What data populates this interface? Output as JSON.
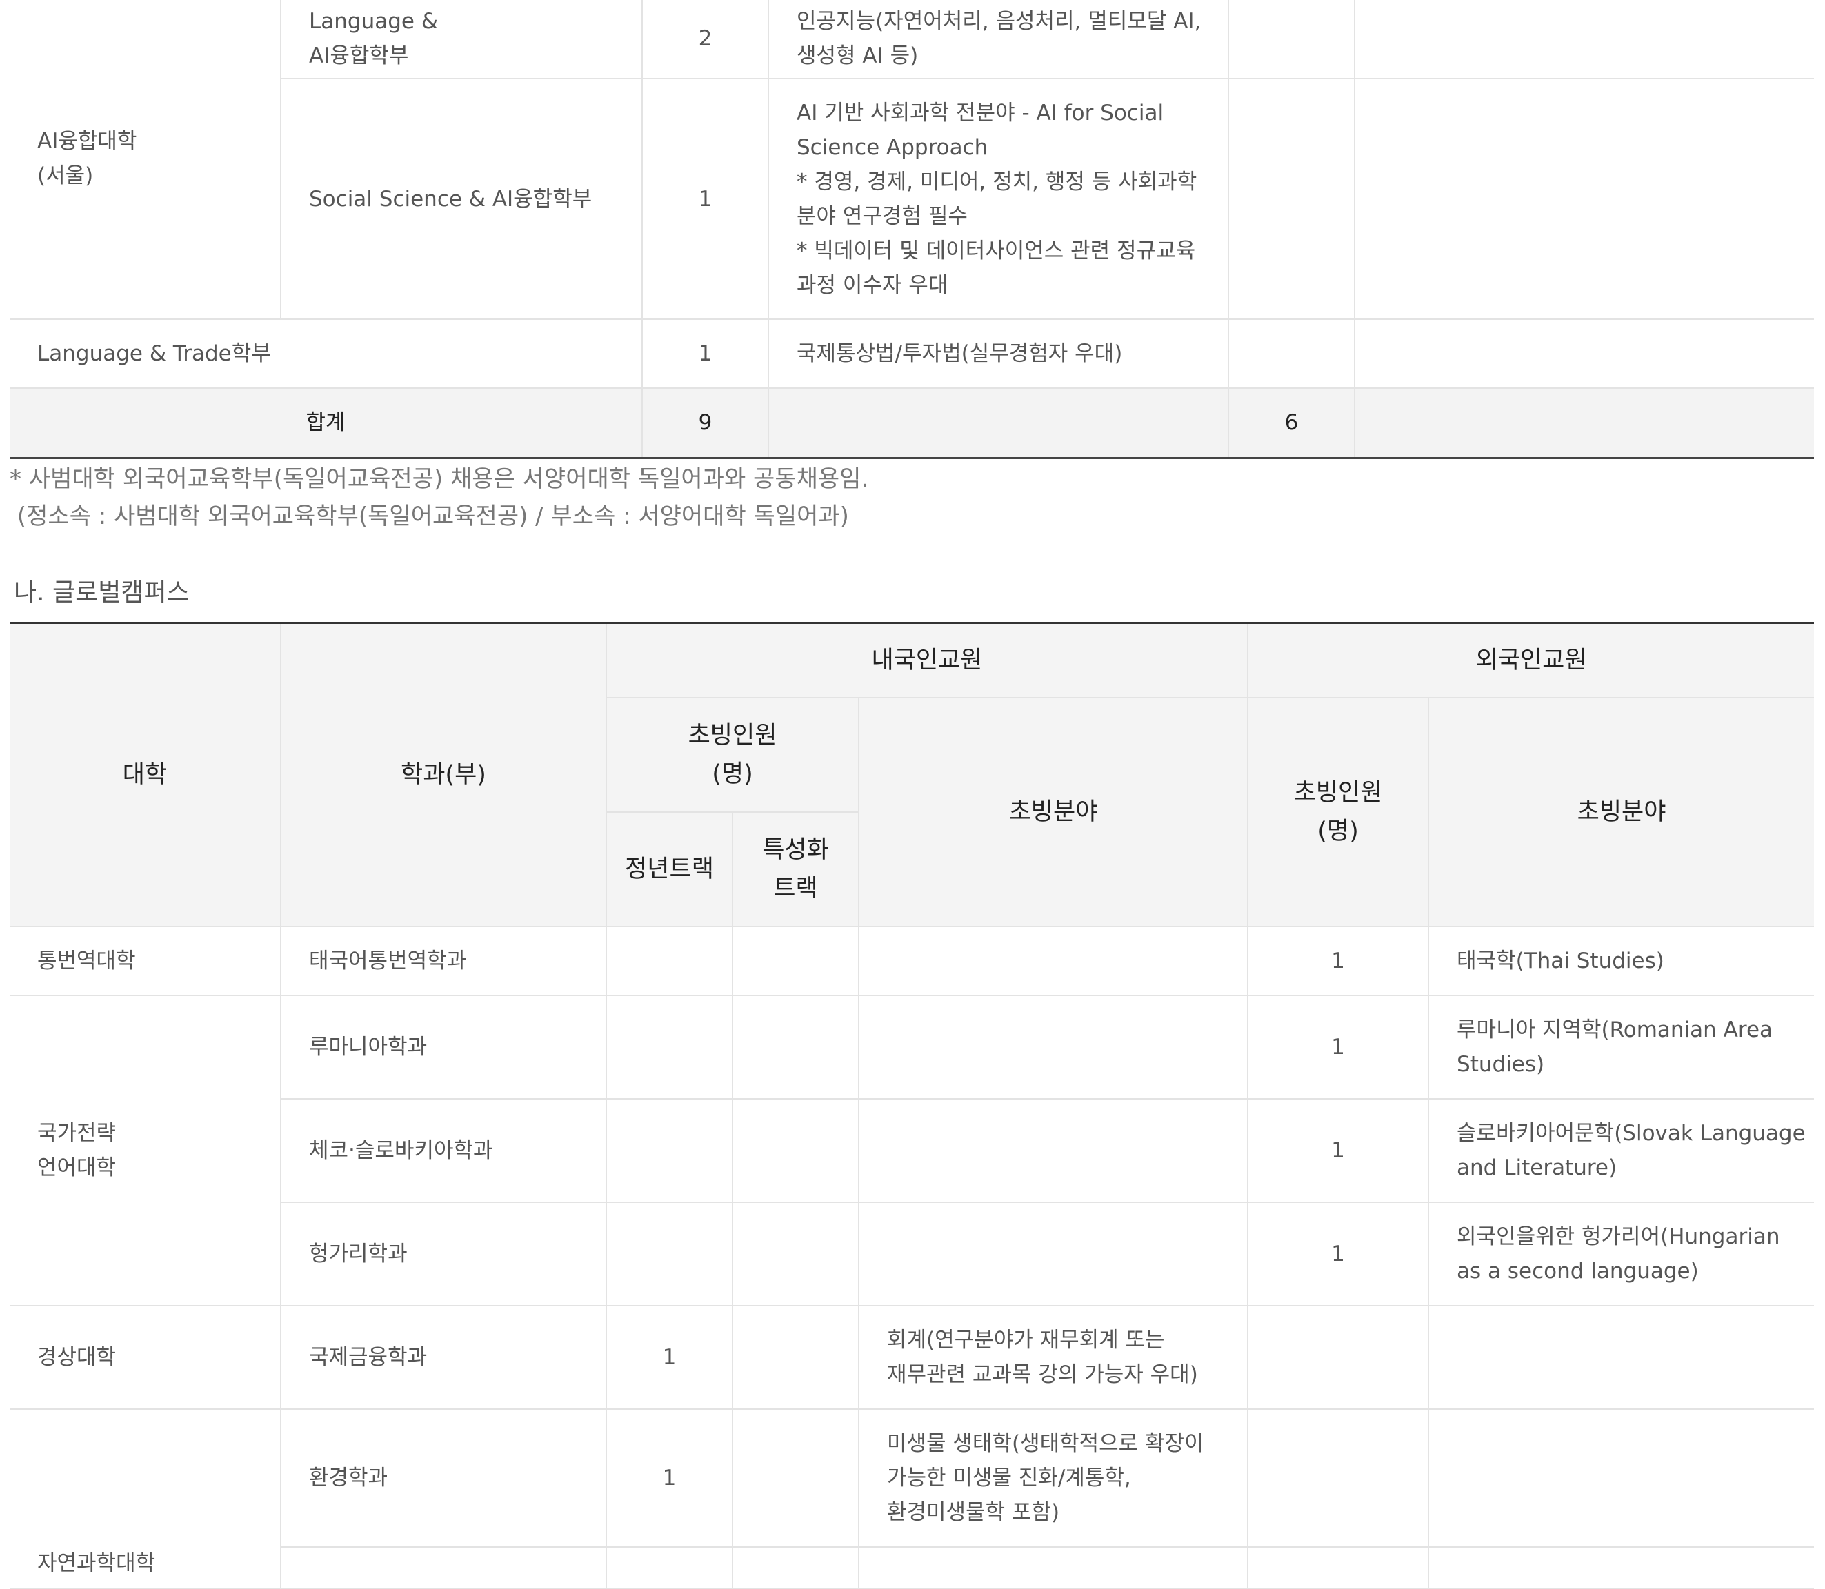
{
  "upper_table": {
    "rows": [
      {
        "college": "AI융합대학\n(서울)",
        "department": "Language &\nAI융합학부",
        "count": "2",
        "field": "인공지능(자연어처리, 음성처리, 멀티모달 AI,\n생성형 AI 등)",
        "foreign_count": "",
        "foreign_field": ""
      },
      {
        "department": "Social Science & AI융합학부",
        "count": "1",
        "field": "AI 기반 사회과학 전분야 - AI for Social\nScience Approach\n* 경영, 경제, 미디어, 정치, 행정 등 사회과학\n분야 연구경험 필수\n* 빅데이터 및 데이터사이언스 관련 정규교육\n과정 이수자 우대",
        "foreign_count": "",
        "foreign_field": ""
      },
      {
        "department": "Language & Trade학부",
        "count": "1",
        "field": "국제통상법/투자법(실무경험자 우대)",
        "foreign_count": "",
        "foreign_field": ""
      }
    ],
    "total": {
      "label": "합계",
      "count": "9",
      "foreign_count": "6"
    }
  },
  "notes": [
    "* 사범대학 외국어교육학부(독일어교육전공) 채용은 서양어대학 독일어과와 공동채용임.",
    " (정소속 : 사범대학 외국어교육학부(독일어교육전공) / 부소속 : 서양어대학 독일어과)"
  ],
  "section_title": "나. 글로벌캠퍼스",
  "global_table": {
    "headers": {
      "college": "대학",
      "department": "학과(부)",
      "domestic": "내국인교원",
      "foreign": "외국인교원",
      "invite_count": "초빙인원\n(명)",
      "invite_field": "초빙분야",
      "tenure_track": "정년트랙",
      "special_track": "특성화\n트랙"
    },
    "rows": [
      {
        "college": "통번역대학",
        "department": "태국어통번역학과",
        "tenure": "",
        "special": "",
        "field": "",
        "foreign_count": "1",
        "foreign_field": "태국학(Thai Studies)"
      },
      {
        "college": "국가전략\n언어대학",
        "department": "루마니아학과",
        "tenure": "",
        "special": "",
        "field": "",
        "foreign_count": "1",
        "foreign_field": "루마니아 지역학(Romanian Area\nStudies)"
      },
      {
        "department": "체코·슬로바키아학과",
        "tenure": "",
        "special": "",
        "field": "",
        "foreign_count": "1",
        "foreign_field": "슬로바키아어문학(Slovak Language\nand Literature)"
      },
      {
        "department": "헝가리학과",
        "tenure": "",
        "special": "",
        "field": "",
        "foreign_count": "1",
        "foreign_field": "외국인을위한 헝가리어(Hungarian\nas a second language)"
      },
      {
        "college": "경상대학",
        "department": "국제금융학과",
        "tenure": "1",
        "special": "",
        "field": "회계(연구분야가 재무회계 또는\n재무관련 교과목 강의 가능자 우대)",
        "foreign_count": "",
        "foreign_field": ""
      },
      {
        "college": "자연과학대학",
        "department": "환경학과",
        "tenure": "1",
        "special": "",
        "field": "미생물 생태학(생태학적으로 확장이\n가능한 미생물 진화/계통학,\n환경미생물학 포함)",
        "foreign_count": "",
        "foreign_field": ""
      }
    ]
  }
}
